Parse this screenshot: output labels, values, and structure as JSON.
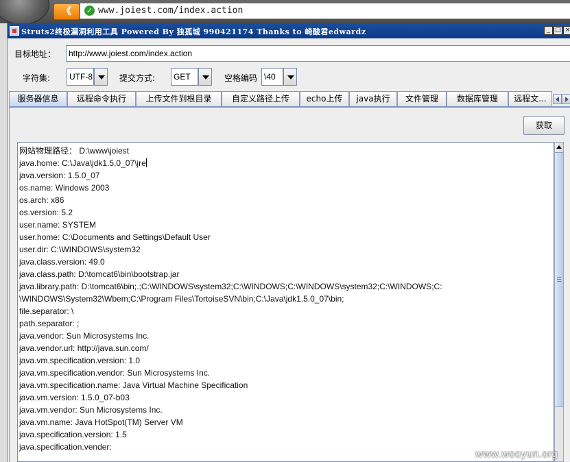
{
  "browser": {
    "back_label": "《",
    "url": "www.joiest.com/index.action"
  },
  "window": {
    "title": "Struts2终极漏洞利用工具   Powered By 独孤城 990421174 Thanks to 崎酸君edwardz",
    "minimize": "_",
    "maximize": "□",
    "close": "×"
  },
  "form": {
    "target_label": "目标地址：",
    "target_value": "http://www.joiest.com/index.action",
    "charset_label": "字符集:",
    "charset_value": "UTF-8",
    "method_label": "提交方式:",
    "method_value": "GET",
    "space_label": "空格编码",
    "space_value": "\\40"
  },
  "tabs": [
    {
      "label": "服务器信息"
    },
    {
      "label": "远程命令执行"
    },
    {
      "label": "上传文件到根目录"
    },
    {
      "label": "自定义路径上传"
    },
    {
      "label": "echo上传"
    },
    {
      "label": "java执行"
    },
    {
      "label": "文件管理"
    },
    {
      "label": "数据库管理"
    },
    {
      "label": "远程文..."
    }
  ],
  "fetch_label": "获取",
  "output_lines": [
    "网站物理路径：  D:\\www\\joiest",
    "java.home: C:\\Java\\jdk1.5.0_07\\jre",
    "java.version: 1.5.0_07",
    "os.name: Windows 2003",
    "os.arch: x86",
    "os.version: 5.2",
    "user.name: SYSTEM",
    "user.home: C:\\Documents and Settings\\Default User",
    "user.dir: C:\\WINDOWS\\system32",
    "java.class.version: 49.0",
    "java.class.path: D:\\tomcat6\\bin\\bootstrap.jar",
    "java.library.path: D:\\tomcat6\\bin;.;C:\\WINDOWS\\system32;C:\\WINDOWS;C:\\WINDOWS\\system32;C:\\WINDOWS;C:",
    "\\WINDOWS\\System32\\Wbem;C:\\Program Files\\TortoiseSVN\\bin;C:\\Java\\jdk1.5.0_07\\bin;",
    "file.separator: \\",
    "path.separator: ;",
    "java.vendor: Sun Microsystems Inc.",
    "java.vendor.url: http://java.sun.com/",
    "java.vm.specification.version: 1.0",
    "java.vm.specification.vendor: Sun Microsystems Inc.",
    "java.vm.specification.name: Java Virtual Machine Specification",
    "java.vm.version: 1.5.0_07-b03",
    "java.vm.vendor: Sun Microsystems Inc.",
    "java.vm.name: Java HotSpot(TM) Server VM",
    "java.specification.version: 1.5",
    "java.specification.vender:"
  ],
  "watermark": "www.wooyun.org"
}
